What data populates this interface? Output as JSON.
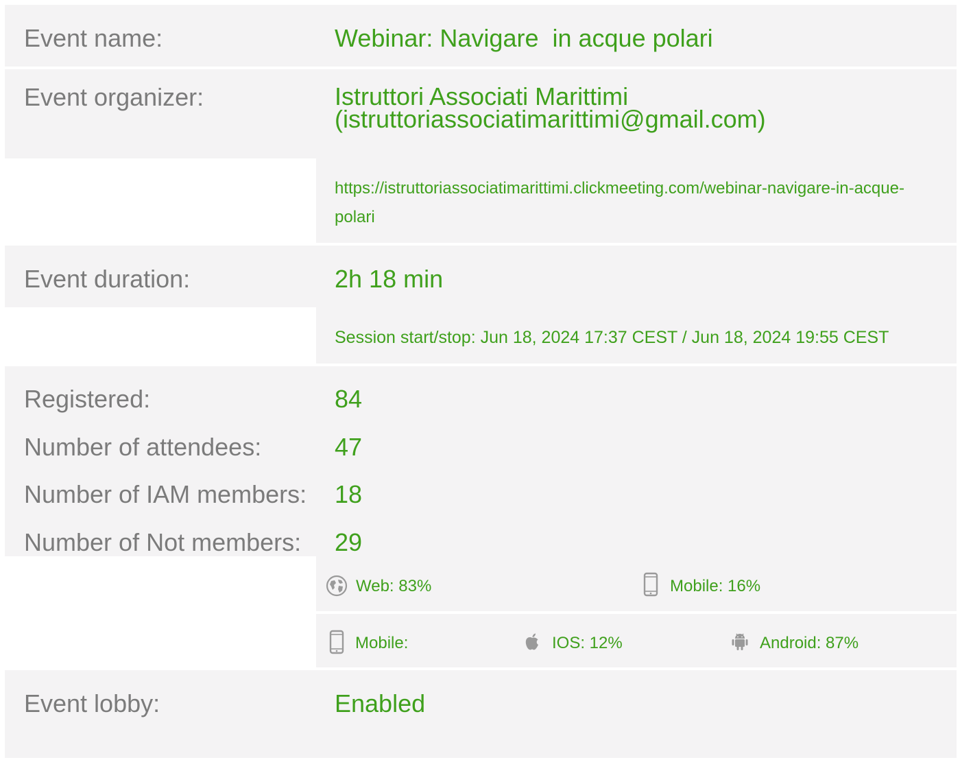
{
  "event": {
    "name_label": "Event name:",
    "name_value": "Webinar: Navigare  in acque polari",
    "organizer_label": "Event organizer:",
    "organizer_line1": "Istruttori Associati Marittimi",
    "organizer_line2": "(istruttoriassociatimarittimi@gmail.com)",
    "url": "https://istruttoriassociatimarittimi.clickmeeting.com/webinar-navigare-in-acque-polari",
    "duration_label": "Event duration:",
    "duration_value": "2h 18 min",
    "session": "Session start/stop: Jun 18, 2024 17:37 CEST / Jun 18, 2024 19:55 CEST",
    "lobby_label": "Event lobby:",
    "lobby_value": "Enabled"
  },
  "stats": [
    {
      "label": "Registered:",
      "value": "84"
    },
    {
      "label": "Number of attendees:",
      "value": "47"
    },
    {
      "label": "Number of IAM members:",
      "value": "18"
    },
    {
      "label": "Number of Not members:",
      "value": "29"
    }
  ],
  "platform": {
    "web": "Web: 83%",
    "mobile": "Mobile: 16%"
  },
  "mobile_os": {
    "label": "Mobile:",
    "ios": "IOS: 12%",
    "android": "Android: 87%"
  },
  "icons": [
    "globe-icon",
    "mobile-phone-icon",
    "apple-icon",
    "android-icon"
  ],
  "colors": {
    "value_green": "#3fa01c",
    "label_gray": "#7b7b7b",
    "panel_bg": "#f4f3f4"
  }
}
